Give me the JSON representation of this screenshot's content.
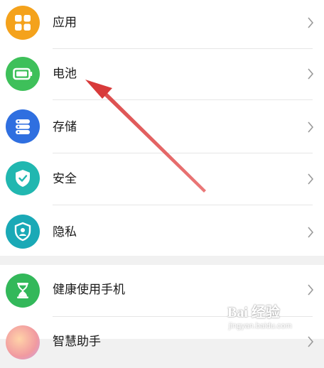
{
  "settings": {
    "items": [
      {
        "label": "应用",
        "icon": "apps-icon",
        "color": "#f4a21c"
      },
      {
        "label": "电池",
        "icon": "battery-icon",
        "color": "#3ec05a"
      },
      {
        "label": "存储",
        "icon": "storage-icon",
        "color": "#2f6fe0"
      },
      {
        "label": "安全",
        "icon": "shield-check-icon",
        "color": "#21b7b0"
      },
      {
        "label": "隐私",
        "icon": "privacy-shield-icon",
        "color": "#1aa9b6"
      }
    ],
    "items2": [
      {
        "label": "健康使用手机",
        "icon": "hourglass-icon",
        "color": "#33b85a"
      },
      {
        "label": "智慧助手",
        "icon": "assistant-icon",
        "color": "#f0a0a0"
      }
    ]
  },
  "watermark": {
    "brand": "Bai 经验",
    "url": "jingyan.baidu.com"
  },
  "annotation": {
    "arrow_color": "#d83a3a"
  }
}
